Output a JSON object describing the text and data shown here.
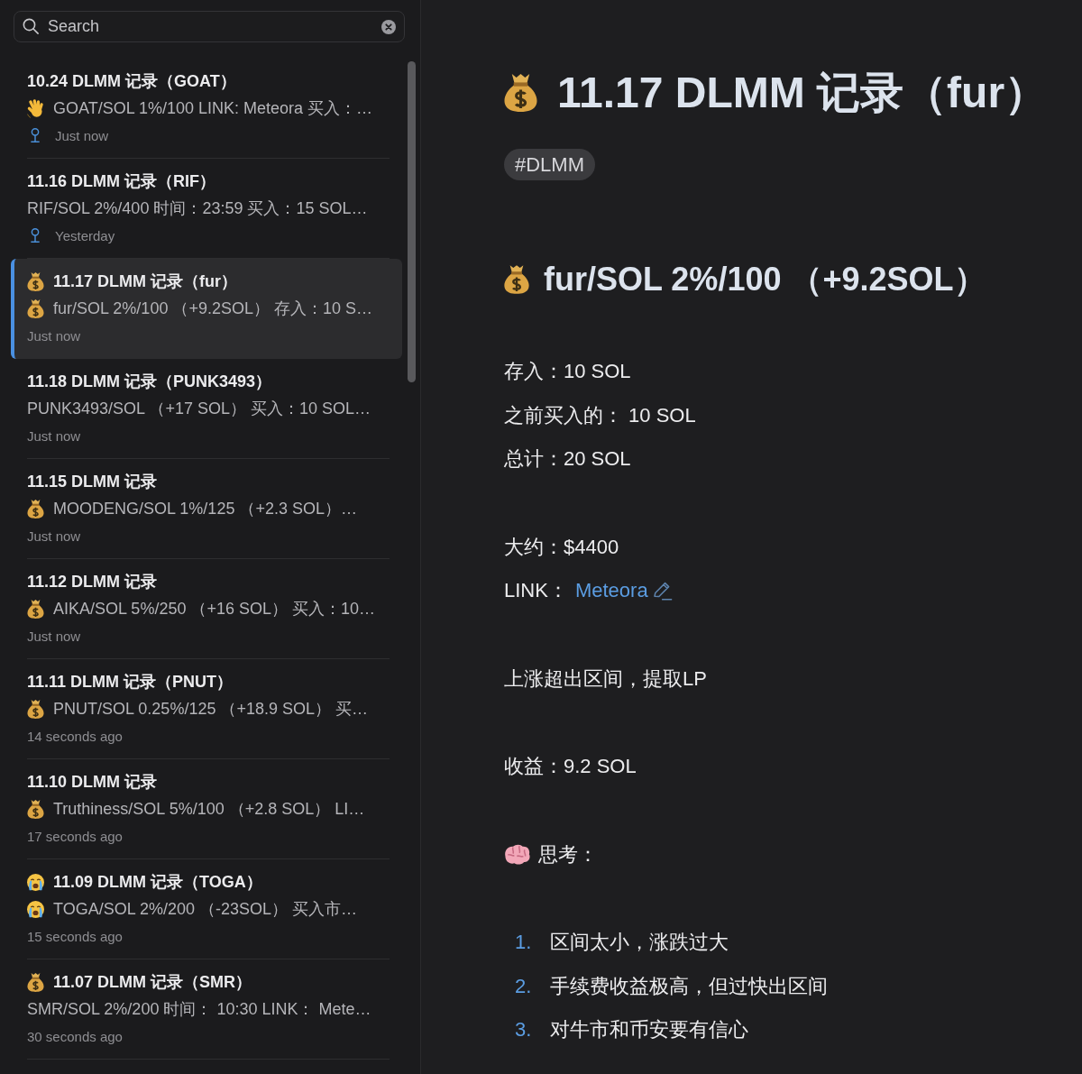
{
  "search": {
    "placeholder": "Search"
  },
  "notes": [
    {
      "title": "10.24 DLMM 记录（GOAT）",
      "preview_icon": {
        "kind": "waving_hand"
      },
      "preview": "GOAT/SOL 1%/100 LINK: Meteora 买入：…",
      "pinned": true,
      "time": "Just now",
      "selected": false
    },
    {
      "title": "11.16 DLMM 记录（RIF）",
      "preview": "RIF/SOL 2%/400 时间：23:59 买入：15 SOL…",
      "pinned": true,
      "time": "Yesterday",
      "selected": false
    },
    {
      "title_icon": {
        "kind": "money_bag"
      },
      "title": "11.17 DLMM 记录（fur）",
      "preview_icon": {
        "kind": "money_bag"
      },
      "preview": "fur/SOL 2%/100 （+9.2SOL） 存入：10 S…",
      "pinned": false,
      "time": "Just now",
      "selected": true
    },
    {
      "title": "11.18 DLMM 记录（PUNK3493）",
      "preview": "PUNK3493/SOL （+17 SOL） 买入：10 SOL…",
      "pinned": false,
      "time": "Just now",
      "selected": false
    },
    {
      "title": "11.15 DLMM 记录",
      "preview_icon": {
        "kind": "money_bag"
      },
      "preview": "MOODENG/SOL 1%/125 （+2.3 SOL）…",
      "pinned": false,
      "time": "Just now",
      "selected": false
    },
    {
      "title": "11.12 DLMM 记录",
      "preview_icon": {
        "kind": "money_bag"
      },
      "preview": "AIKA/SOL 5%/250 （+16 SOL） 买入：10…",
      "pinned": false,
      "time": "Just now",
      "selected": false
    },
    {
      "title": "11.11 DLMM 记录（PNUT）",
      "preview_icon": {
        "kind": "money_bag"
      },
      "preview": "PNUT/SOL 0.25%/125 （+18.9 SOL） 买…",
      "pinned": false,
      "time": "14 seconds ago",
      "selected": false
    },
    {
      "title": "11.10 DLMM 记录",
      "preview_icon": {
        "kind": "money_bag"
      },
      "preview": "Truthiness/SOL 5%/100 （+2.8 SOL） LI…",
      "pinned": false,
      "time": "17 seconds ago",
      "selected": false
    },
    {
      "title_icon": {
        "kind": "crying_face"
      },
      "title": "11.09 DLMM 记录（TOGA）",
      "preview_icon": {
        "kind": "crying_face"
      },
      "preview": "TOGA/SOL 2%/200 （-23SOL） 买入市…",
      "pinned": false,
      "time": "15 seconds ago",
      "selected": false
    },
    {
      "title_icon": {
        "kind": "money_bag"
      },
      "title": "11.07 DLMM 记录（SMR）",
      "preview": "SMR/SOL 2%/200 时间： 10:30 LINK： Mete…",
      "pinned": false,
      "time": "30 seconds ago",
      "selected": false
    }
  ],
  "note": {
    "title_icon": {
      "kind": "money_bag"
    },
    "title": "11.17 DLMM 记录（fur）",
    "tag": "#DLMM",
    "section_heading": {
      "icon": {
        "kind": "money_bag"
      },
      "text": "fur/SOL 2%/100 （+9.2SOL）"
    },
    "body": [
      {
        "kind": "paragraph",
        "lines": [
          {
            "text": "存入：10 SOL"
          },
          {
            "text": "之前买入的： 10 SOL"
          },
          {
            "text": "总计：20 SOL"
          }
        ]
      },
      {
        "kind": "paragraph",
        "lines": [
          {
            "text": "大约：$4400"
          },
          {
            "text": "LINK：",
            "link": "Meteora"
          }
        ]
      },
      {
        "kind": "paragraph",
        "lines": [
          {
            "text": "上涨超出区间，提取LP"
          }
        ]
      },
      {
        "kind": "paragraph",
        "lines": [
          {
            "text": "收益：9.2 SOL"
          }
        ]
      },
      {
        "kind": "paragraph",
        "lines": [
          {
            "icon": {
              "kind": "brain"
            },
            "text": "思考："
          }
        ]
      },
      {
        "kind": "numbered_list",
        "items": [
          {
            "number": "1.",
            "text": "区间太小，涨跌过大"
          },
          {
            "number": "2.",
            "text": "手续费收益极高，但过快出区间"
          },
          {
            "number": "3.",
            "text": "对牛市和币安要有信心"
          }
        ]
      }
    ]
  }
}
